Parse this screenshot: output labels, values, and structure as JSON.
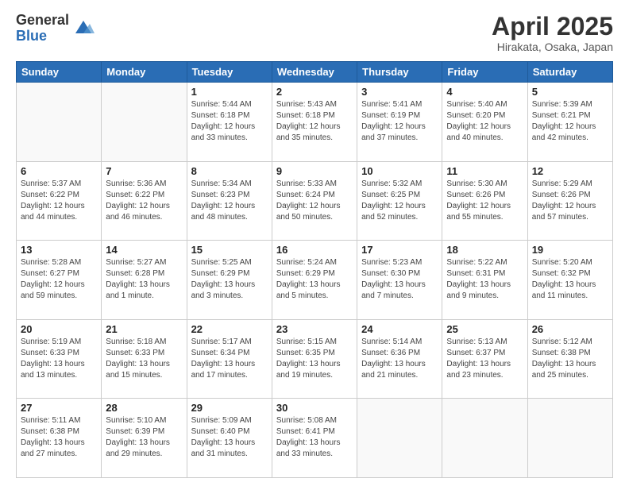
{
  "header": {
    "logo_general": "General",
    "logo_blue": "Blue",
    "title": "April 2025",
    "location": "Hirakata, Osaka, Japan"
  },
  "days_of_week": [
    "Sunday",
    "Monday",
    "Tuesday",
    "Wednesday",
    "Thursday",
    "Friday",
    "Saturday"
  ],
  "weeks": [
    [
      {
        "day": "",
        "info": ""
      },
      {
        "day": "",
        "info": ""
      },
      {
        "day": "1",
        "info": "Sunrise: 5:44 AM\nSunset: 6:18 PM\nDaylight: 12 hours and 33 minutes."
      },
      {
        "day": "2",
        "info": "Sunrise: 5:43 AM\nSunset: 6:18 PM\nDaylight: 12 hours and 35 minutes."
      },
      {
        "day": "3",
        "info": "Sunrise: 5:41 AM\nSunset: 6:19 PM\nDaylight: 12 hours and 37 minutes."
      },
      {
        "day": "4",
        "info": "Sunrise: 5:40 AM\nSunset: 6:20 PM\nDaylight: 12 hours and 40 minutes."
      },
      {
        "day": "5",
        "info": "Sunrise: 5:39 AM\nSunset: 6:21 PM\nDaylight: 12 hours and 42 minutes."
      }
    ],
    [
      {
        "day": "6",
        "info": "Sunrise: 5:37 AM\nSunset: 6:22 PM\nDaylight: 12 hours and 44 minutes."
      },
      {
        "day": "7",
        "info": "Sunrise: 5:36 AM\nSunset: 6:22 PM\nDaylight: 12 hours and 46 minutes."
      },
      {
        "day": "8",
        "info": "Sunrise: 5:34 AM\nSunset: 6:23 PM\nDaylight: 12 hours and 48 minutes."
      },
      {
        "day": "9",
        "info": "Sunrise: 5:33 AM\nSunset: 6:24 PM\nDaylight: 12 hours and 50 minutes."
      },
      {
        "day": "10",
        "info": "Sunrise: 5:32 AM\nSunset: 6:25 PM\nDaylight: 12 hours and 52 minutes."
      },
      {
        "day": "11",
        "info": "Sunrise: 5:30 AM\nSunset: 6:26 PM\nDaylight: 12 hours and 55 minutes."
      },
      {
        "day": "12",
        "info": "Sunrise: 5:29 AM\nSunset: 6:26 PM\nDaylight: 12 hours and 57 minutes."
      }
    ],
    [
      {
        "day": "13",
        "info": "Sunrise: 5:28 AM\nSunset: 6:27 PM\nDaylight: 12 hours and 59 minutes."
      },
      {
        "day": "14",
        "info": "Sunrise: 5:27 AM\nSunset: 6:28 PM\nDaylight: 13 hours and 1 minute."
      },
      {
        "day": "15",
        "info": "Sunrise: 5:25 AM\nSunset: 6:29 PM\nDaylight: 13 hours and 3 minutes."
      },
      {
        "day": "16",
        "info": "Sunrise: 5:24 AM\nSunset: 6:29 PM\nDaylight: 13 hours and 5 minutes."
      },
      {
        "day": "17",
        "info": "Sunrise: 5:23 AM\nSunset: 6:30 PM\nDaylight: 13 hours and 7 minutes."
      },
      {
        "day": "18",
        "info": "Sunrise: 5:22 AM\nSunset: 6:31 PM\nDaylight: 13 hours and 9 minutes."
      },
      {
        "day": "19",
        "info": "Sunrise: 5:20 AM\nSunset: 6:32 PM\nDaylight: 13 hours and 11 minutes."
      }
    ],
    [
      {
        "day": "20",
        "info": "Sunrise: 5:19 AM\nSunset: 6:33 PM\nDaylight: 13 hours and 13 minutes."
      },
      {
        "day": "21",
        "info": "Sunrise: 5:18 AM\nSunset: 6:33 PM\nDaylight: 13 hours and 15 minutes."
      },
      {
        "day": "22",
        "info": "Sunrise: 5:17 AM\nSunset: 6:34 PM\nDaylight: 13 hours and 17 minutes."
      },
      {
        "day": "23",
        "info": "Sunrise: 5:15 AM\nSunset: 6:35 PM\nDaylight: 13 hours and 19 minutes."
      },
      {
        "day": "24",
        "info": "Sunrise: 5:14 AM\nSunset: 6:36 PM\nDaylight: 13 hours and 21 minutes."
      },
      {
        "day": "25",
        "info": "Sunrise: 5:13 AM\nSunset: 6:37 PM\nDaylight: 13 hours and 23 minutes."
      },
      {
        "day": "26",
        "info": "Sunrise: 5:12 AM\nSunset: 6:38 PM\nDaylight: 13 hours and 25 minutes."
      }
    ],
    [
      {
        "day": "27",
        "info": "Sunrise: 5:11 AM\nSunset: 6:38 PM\nDaylight: 13 hours and 27 minutes."
      },
      {
        "day": "28",
        "info": "Sunrise: 5:10 AM\nSunset: 6:39 PM\nDaylight: 13 hours and 29 minutes."
      },
      {
        "day": "29",
        "info": "Sunrise: 5:09 AM\nSunset: 6:40 PM\nDaylight: 13 hours and 31 minutes."
      },
      {
        "day": "30",
        "info": "Sunrise: 5:08 AM\nSunset: 6:41 PM\nDaylight: 13 hours and 33 minutes."
      },
      {
        "day": "",
        "info": ""
      },
      {
        "day": "",
        "info": ""
      },
      {
        "day": "",
        "info": ""
      }
    ]
  ]
}
